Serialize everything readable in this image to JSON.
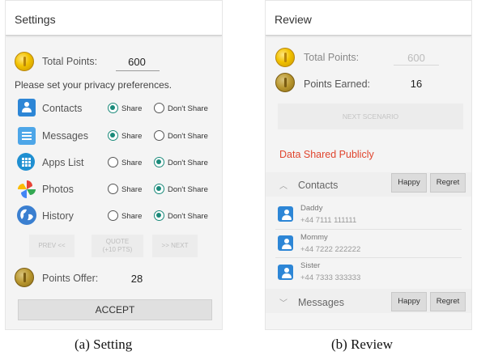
{
  "panel_a": {
    "title": "Settings",
    "total_points_label": "Total Points:",
    "total_points_value": "600",
    "prompt": "Please set your privacy preferences.",
    "rows": [
      {
        "label": "Contacts",
        "icon": "contacts-icon",
        "share": true
      },
      {
        "label": "Messages",
        "icon": "messages-icon",
        "share": true
      },
      {
        "label": "Apps List",
        "icon": "apps-list-icon",
        "share": false
      },
      {
        "label": "Photos",
        "icon": "photos-icon",
        "share": false
      },
      {
        "label": "History",
        "icon": "history-icon",
        "share": false
      }
    ],
    "share_label": "Share",
    "dont_share_label": "Don't Share",
    "prev_label": "PREV <<",
    "quote_label": "QUOTE",
    "quote_sub": "(+10 PTS)",
    "next_label": ">> NEXT",
    "points_offer_label": "Points Offer:",
    "points_offer_value": "28",
    "accept_label": "ACCEPT"
  },
  "panel_b": {
    "title": "Review",
    "total_points_label": "Total Points:",
    "total_points_value": "600",
    "points_earned_label": "Points Earned:",
    "points_earned_value": "16",
    "next_scenario_label": "NEXT SCENARIO",
    "shared_heading": "Data Shared Publicly",
    "contacts_label": "Contacts",
    "messages_label": "Messages",
    "happy_label": "Happy",
    "regret_label": "Regret",
    "contacts": [
      {
        "name": "Daddy",
        "number": "+44 7111 111111"
      },
      {
        "name": "Mommy",
        "number": "+44 7222 222222"
      },
      {
        "name": "Sister",
        "number": "+44 7333 333333"
      }
    ]
  },
  "captions": {
    "a": "(a) Setting",
    "b": "(b) Review"
  },
  "colors": {
    "accent_radio": "#1a8a7a",
    "shared_heading": "#e0452e",
    "coin_gold": "#f2c200"
  }
}
